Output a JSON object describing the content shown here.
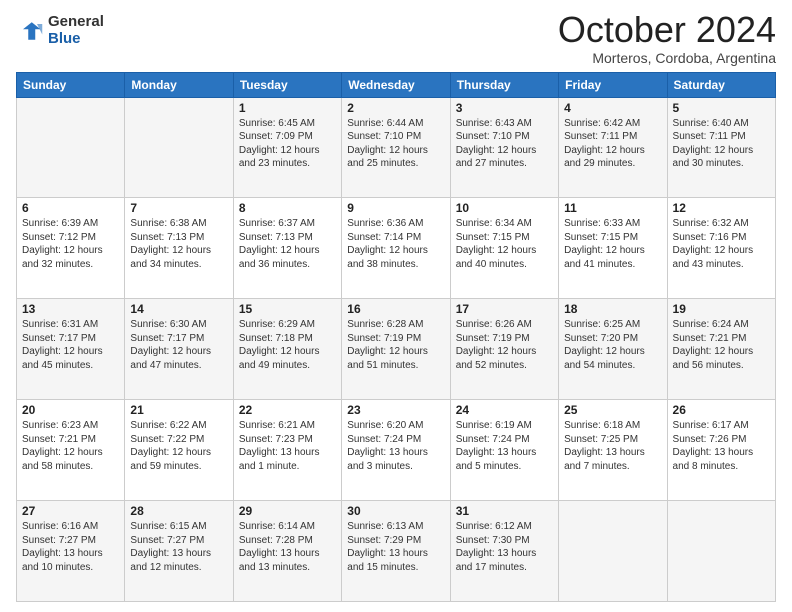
{
  "header": {
    "logo_general": "General",
    "logo_blue": "Blue",
    "month_title": "October 2024",
    "location": "Morteros, Cordoba, Argentina"
  },
  "weekdays": [
    "Sunday",
    "Monday",
    "Tuesday",
    "Wednesday",
    "Thursday",
    "Friday",
    "Saturday"
  ],
  "weeks": [
    [
      {
        "day": "",
        "info": ""
      },
      {
        "day": "",
        "info": ""
      },
      {
        "day": "1",
        "info": "Sunrise: 6:45 AM\nSunset: 7:09 PM\nDaylight: 12 hours and 23 minutes."
      },
      {
        "day": "2",
        "info": "Sunrise: 6:44 AM\nSunset: 7:10 PM\nDaylight: 12 hours and 25 minutes."
      },
      {
        "day": "3",
        "info": "Sunrise: 6:43 AM\nSunset: 7:10 PM\nDaylight: 12 hours and 27 minutes."
      },
      {
        "day": "4",
        "info": "Sunrise: 6:42 AM\nSunset: 7:11 PM\nDaylight: 12 hours and 29 minutes."
      },
      {
        "day": "5",
        "info": "Sunrise: 6:40 AM\nSunset: 7:11 PM\nDaylight: 12 hours and 30 minutes."
      }
    ],
    [
      {
        "day": "6",
        "info": "Sunrise: 6:39 AM\nSunset: 7:12 PM\nDaylight: 12 hours and 32 minutes."
      },
      {
        "day": "7",
        "info": "Sunrise: 6:38 AM\nSunset: 7:13 PM\nDaylight: 12 hours and 34 minutes."
      },
      {
        "day": "8",
        "info": "Sunrise: 6:37 AM\nSunset: 7:13 PM\nDaylight: 12 hours and 36 minutes."
      },
      {
        "day": "9",
        "info": "Sunrise: 6:36 AM\nSunset: 7:14 PM\nDaylight: 12 hours and 38 minutes."
      },
      {
        "day": "10",
        "info": "Sunrise: 6:34 AM\nSunset: 7:15 PM\nDaylight: 12 hours and 40 minutes."
      },
      {
        "day": "11",
        "info": "Sunrise: 6:33 AM\nSunset: 7:15 PM\nDaylight: 12 hours and 41 minutes."
      },
      {
        "day": "12",
        "info": "Sunrise: 6:32 AM\nSunset: 7:16 PM\nDaylight: 12 hours and 43 minutes."
      }
    ],
    [
      {
        "day": "13",
        "info": "Sunrise: 6:31 AM\nSunset: 7:17 PM\nDaylight: 12 hours and 45 minutes."
      },
      {
        "day": "14",
        "info": "Sunrise: 6:30 AM\nSunset: 7:17 PM\nDaylight: 12 hours and 47 minutes."
      },
      {
        "day": "15",
        "info": "Sunrise: 6:29 AM\nSunset: 7:18 PM\nDaylight: 12 hours and 49 minutes."
      },
      {
        "day": "16",
        "info": "Sunrise: 6:28 AM\nSunset: 7:19 PM\nDaylight: 12 hours and 51 minutes."
      },
      {
        "day": "17",
        "info": "Sunrise: 6:26 AM\nSunset: 7:19 PM\nDaylight: 12 hours and 52 minutes."
      },
      {
        "day": "18",
        "info": "Sunrise: 6:25 AM\nSunset: 7:20 PM\nDaylight: 12 hours and 54 minutes."
      },
      {
        "day": "19",
        "info": "Sunrise: 6:24 AM\nSunset: 7:21 PM\nDaylight: 12 hours and 56 minutes."
      }
    ],
    [
      {
        "day": "20",
        "info": "Sunrise: 6:23 AM\nSunset: 7:21 PM\nDaylight: 12 hours and 58 minutes."
      },
      {
        "day": "21",
        "info": "Sunrise: 6:22 AM\nSunset: 7:22 PM\nDaylight: 12 hours and 59 minutes."
      },
      {
        "day": "22",
        "info": "Sunrise: 6:21 AM\nSunset: 7:23 PM\nDaylight: 13 hours and 1 minute."
      },
      {
        "day": "23",
        "info": "Sunrise: 6:20 AM\nSunset: 7:24 PM\nDaylight: 13 hours and 3 minutes."
      },
      {
        "day": "24",
        "info": "Sunrise: 6:19 AM\nSunset: 7:24 PM\nDaylight: 13 hours and 5 minutes."
      },
      {
        "day": "25",
        "info": "Sunrise: 6:18 AM\nSunset: 7:25 PM\nDaylight: 13 hours and 7 minutes."
      },
      {
        "day": "26",
        "info": "Sunrise: 6:17 AM\nSunset: 7:26 PM\nDaylight: 13 hours and 8 minutes."
      }
    ],
    [
      {
        "day": "27",
        "info": "Sunrise: 6:16 AM\nSunset: 7:27 PM\nDaylight: 13 hours and 10 minutes."
      },
      {
        "day": "28",
        "info": "Sunrise: 6:15 AM\nSunset: 7:27 PM\nDaylight: 13 hours and 12 minutes."
      },
      {
        "day": "29",
        "info": "Sunrise: 6:14 AM\nSunset: 7:28 PM\nDaylight: 13 hours and 13 minutes."
      },
      {
        "day": "30",
        "info": "Sunrise: 6:13 AM\nSunset: 7:29 PM\nDaylight: 13 hours and 15 minutes."
      },
      {
        "day": "31",
        "info": "Sunrise: 6:12 AM\nSunset: 7:30 PM\nDaylight: 13 hours and 17 minutes."
      },
      {
        "day": "",
        "info": ""
      },
      {
        "day": "",
        "info": ""
      }
    ]
  ]
}
